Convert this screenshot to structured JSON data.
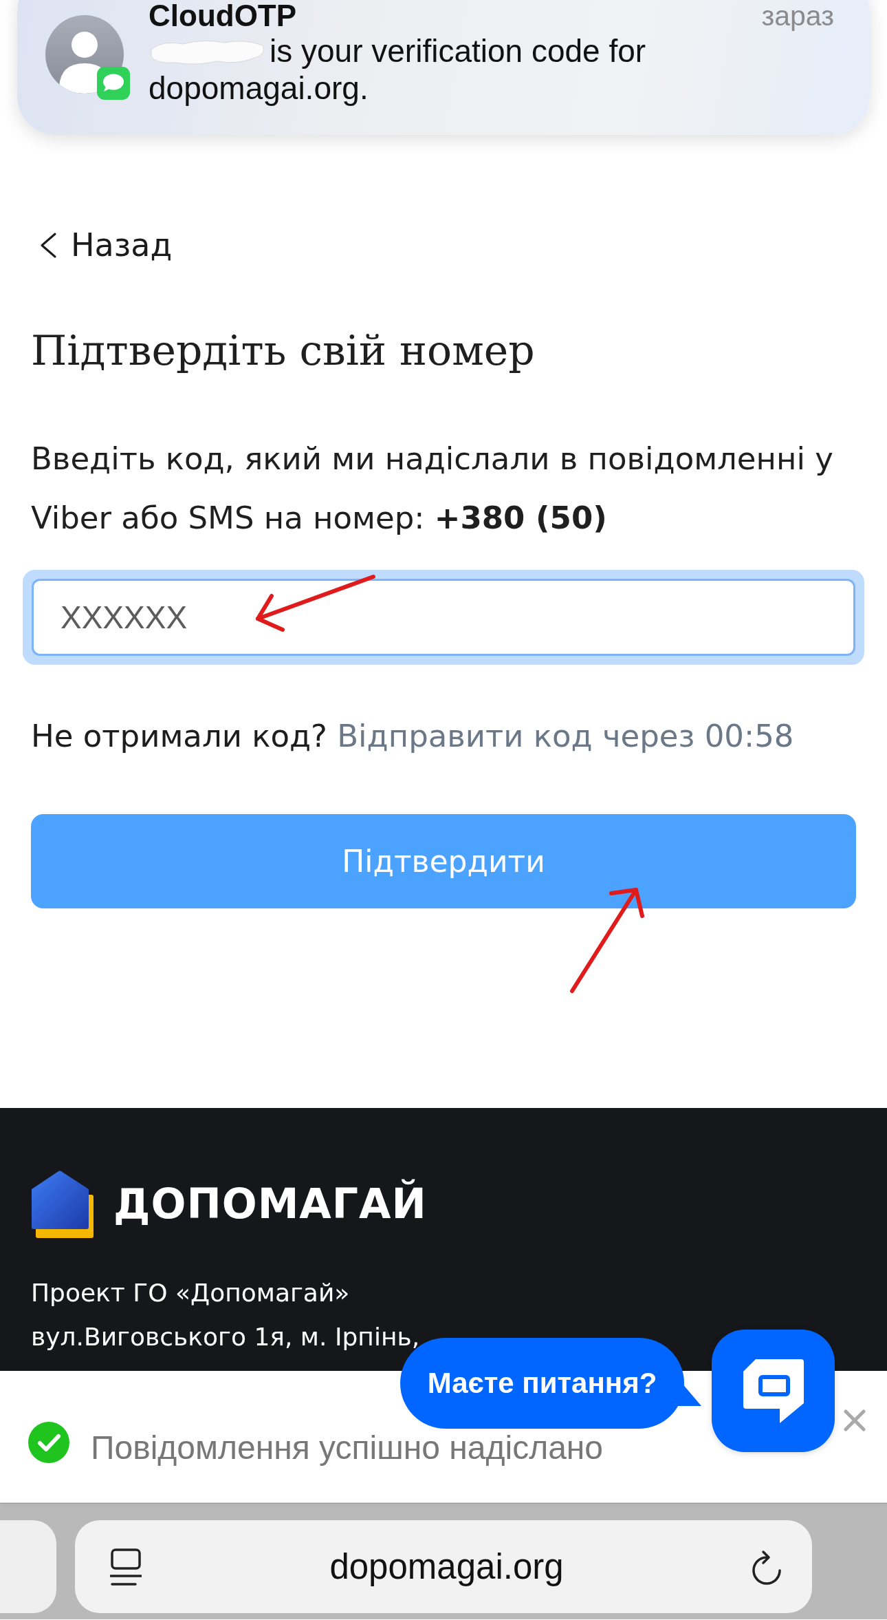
{
  "notification": {
    "app": "CloudOTP",
    "time": "зараз",
    "message_lines": [
      "is your verification code for",
      "dopomagai.org."
    ]
  },
  "back_link": {
    "label": "Назад"
  },
  "title": "Підтвердіть свій номер",
  "instructions": "Введіть код, який ми надіслали в повідомленні у Viber або SMS на номер: **+380 (50)**",
  "code_field": {
    "placeholder": "XXXXXX",
    "focused": true
  },
  "resend": {
    "prompt": "Не отримали код?",
    "link": "Відправити код через 00:58",
    "disabled": true
  },
  "submit_button": {
    "label": "Підтвердити"
  },
  "footer": {
    "logo_text": "ДОПОМАГАЙ",
    "address_lines": [
      "Проект ГО «Допомагай»",
      "вул.Виговського 1я, м. Ірпінь,"
    ]
  },
  "toast": {
    "message": "Повідомлення успішно надіслано"
  },
  "chat_widget": {
    "prompt": "Маєте питання?"
  },
  "browser_bar": {
    "url": "dopomagai.org"
  }
}
